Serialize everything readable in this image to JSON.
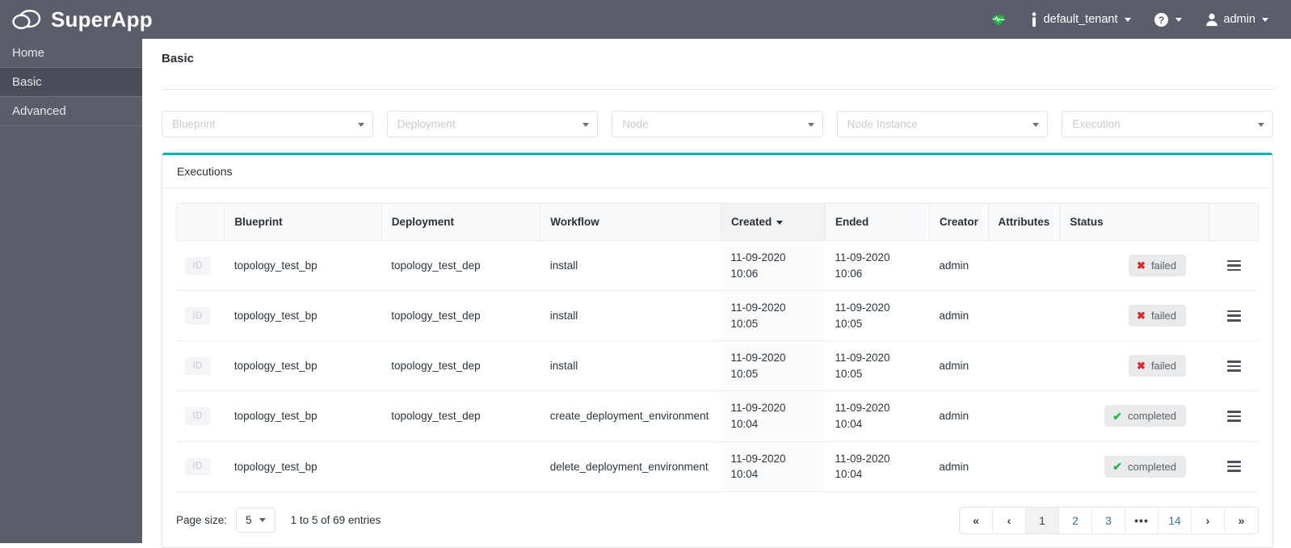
{
  "brand": {
    "name": "SuperApp",
    "logo_icon": "cloud-icon"
  },
  "header": {
    "health_icon": "heartbeat-icon",
    "tenant_icon": "person-icon",
    "tenant": "default_tenant",
    "help_icon": "question-circle-icon",
    "user_icon": "user-icon",
    "user": "admin"
  },
  "sidebar": {
    "items": [
      {
        "label": "Home",
        "active": false
      },
      {
        "label": "Basic",
        "active": true
      },
      {
        "label": "Advanced",
        "active": false
      }
    ]
  },
  "page": {
    "title": "Basic"
  },
  "filters": [
    {
      "name": "blueprint",
      "placeholder": "Blueprint",
      "value": ""
    },
    {
      "name": "deployment",
      "placeholder": "Deployment",
      "value": ""
    },
    {
      "name": "node",
      "placeholder": "Node",
      "value": ""
    },
    {
      "name": "node-instance",
      "placeholder": "Node Instance",
      "value": ""
    },
    {
      "name": "execution",
      "placeholder": "Execution",
      "value": ""
    }
  ],
  "panel": {
    "title": "Executions",
    "accent_color": "#00b5ad"
  },
  "table": {
    "columns": [
      {
        "key": "id",
        "label": ""
      },
      {
        "key": "blueprint",
        "label": "Blueprint"
      },
      {
        "key": "deployment",
        "label": "Deployment"
      },
      {
        "key": "workflow",
        "label": "Workflow"
      },
      {
        "key": "created",
        "label": "Created",
        "sorted": "desc"
      },
      {
        "key": "ended",
        "label": "Ended"
      },
      {
        "key": "creator",
        "label": "Creator"
      },
      {
        "key": "attributes",
        "label": "Attributes"
      },
      {
        "key": "status",
        "label": "Status"
      },
      {
        "key": "menu",
        "label": ""
      }
    ],
    "id_badge_label": "ID",
    "rows": [
      {
        "blueprint": "topology_test_bp",
        "deployment": "topology_test_dep",
        "workflow": "install",
        "created_date": "11-09-2020",
        "created_time": "10:06",
        "ended_date": "11-09-2020",
        "ended_time": "10:06",
        "creator": "admin",
        "attributes": "",
        "status": "failed",
        "status_type": "failed"
      },
      {
        "blueprint": "topology_test_bp",
        "deployment": "topology_test_dep",
        "workflow": "install",
        "created_date": "11-09-2020",
        "created_time": "10:05",
        "ended_date": "11-09-2020",
        "ended_time": "10:05",
        "creator": "admin",
        "attributes": "",
        "status": "failed",
        "status_type": "failed"
      },
      {
        "blueprint": "topology_test_bp",
        "deployment": "topology_test_dep",
        "workflow": "install",
        "created_date": "11-09-2020",
        "created_time": "10:05",
        "ended_date": "11-09-2020",
        "ended_time": "10:05",
        "creator": "admin",
        "attributes": "",
        "status": "failed",
        "status_type": "failed"
      },
      {
        "blueprint": "topology_test_bp",
        "deployment": "topology_test_dep",
        "workflow": "create_deployment_environment",
        "created_date": "11-09-2020",
        "created_time": "10:04",
        "ended_date": "11-09-2020",
        "ended_time": "10:04",
        "creator": "admin",
        "attributes": "",
        "status": "completed",
        "status_type": "completed"
      },
      {
        "blueprint": "topology_test_bp",
        "deployment": "",
        "workflow": "delete_deployment_environment",
        "created_date": "11-09-2020",
        "created_time": "10:04",
        "ended_date": "11-09-2020",
        "ended_time": "10:04",
        "creator": "admin",
        "attributes": "",
        "status": "completed",
        "status_type": "completed"
      }
    ]
  },
  "footer": {
    "page_size_label": "Page size:",
    "page_size_value": "5",
    "entries_info": "1 to 5 of 69 entries",
    "pagination": [
      {
        "label": "«",
        "type": "nav",
        "name": "first-page"
      },
      {
        "label": "‹",
        "type": "nav",
        "name": "prev-page"
      },
      {
        "label": "1",
        "type": "page",
        "active": true,
        "name": "page-1"
      },
      {
        "label": "2",
        "type": "page",
        "active": false,
        "name": "page-2"
      },
      {
        "label": "3",
        "type": "page",
        "active": false,
        "name": "page-3"
      },
      {
        "label": "•••",
        "type": "ellipsis",
        "name": "page-ellipsis"
      },
      {
        "label": "14",
        "type": "page",
        "active": false,
        "name": "page-14"
      },
      {
        "label": "›",
        "type": "nav",
        "name": "next-page"
      },
      {
        "label": "»",
        "type": "nav",
        "name": "last-page"
      }
    ]
  },
  "status_colors": {
    "failed": "#db2828",
    "completed": "#21ba45"
  }
}
